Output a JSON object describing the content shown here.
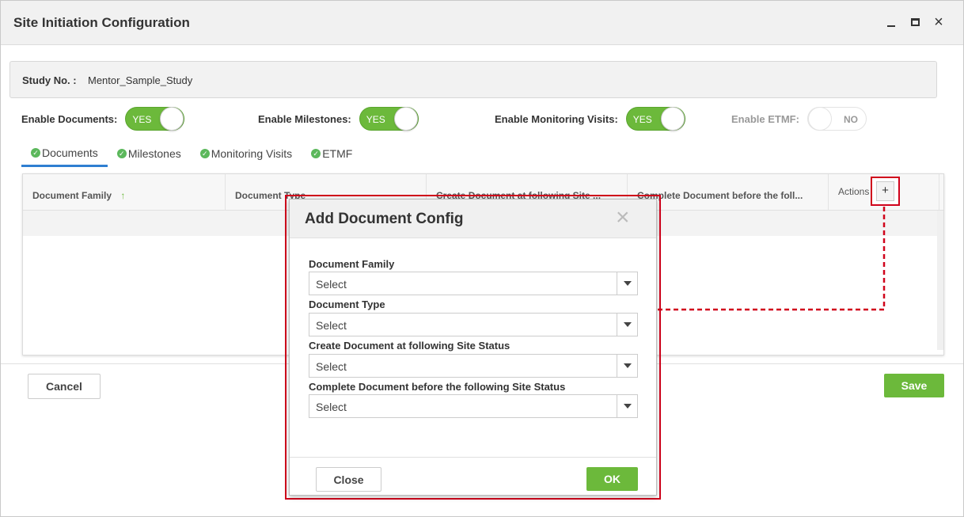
{
  "window": {
    "title": "Site Initiation Configuration",
    "controls": {
      "minimize": "minimize-icon",
      "maximize": "maximize-icon",
      "close": "×"
    }
  },
  "study": {
    "label": "Study No. :",
    "value": "Mentor_Sample_Study"
  },
  "toggles": [
    {
      "label": "Enable Documents:",
      "state": "YES",
      "on": true
    },
    {
      "label": "Enable Milestones:",
      "state": "YES",
      "on": true
    },
    {
      "label": "Enable Monitoring Visits:",
      "state": "YES",
      "on": true
    },
    {
      "label": "Enable ETMF:",
      "state": "NO",
      "on": false
    }
  ],
  "tabs": [
    {
      "label": "Documents",
      "active": true
    },
    {
      "label": "Milestones"
    },
    {
      "label": "Monitoring Visits"
    },
    {
      "label": "ETMF"
    }
  ],
  "grid": {
    "columns": [
      "Document Family",
      "Document Type",
      "Create Document at following Site ...",
      "Complete Document before the foll...",
      "Actions"
    ],
    "add_label": "+",
    "sort_icon": "↑"
  },
  "footer": {
    "cancel": "Cancel",
    "save": "Save"
  },
  "dialog": {
    "title": "Add Document Config",
    "close_glyph": "×",
    "fields": [
      {
        "label": "Document Family",
        "value": "Select"
      },
      {
        "label": "Document Type",
        "value": "Select"
      },
      {
        "label": "Create Document at following Site Status",
        "value": "Select"
      },
      {
        "label": "Complete Document before the following Site Status",
        "value": "Select"
      }
    ],
    "close_label": "Close",
    "ok_label": "OK"
  },
  "colors": {
    "accent_green": "#6cb93b",
    "highlight_red": "#d0021b",
    "tab_blue": "#2f7fd1"
  }
}
